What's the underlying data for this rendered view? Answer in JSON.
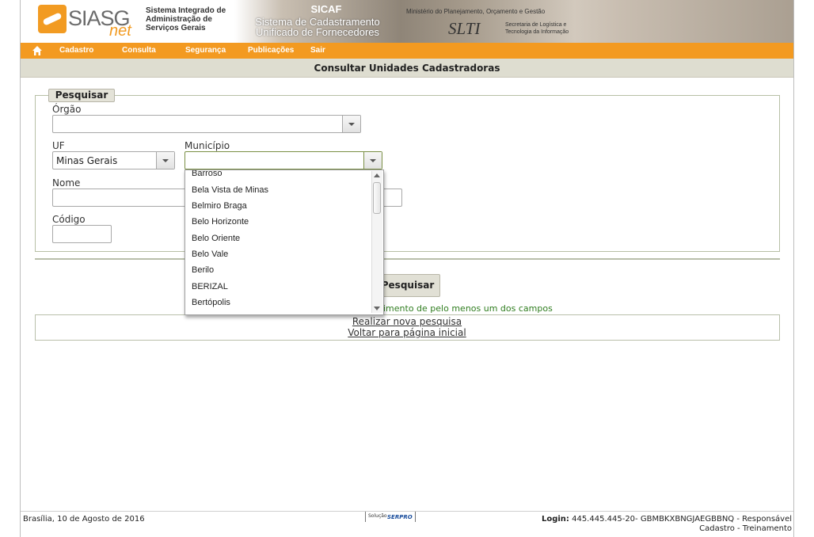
{
  "banner": {
    "logo_text": "SIASG",
    "logo_sub": "net",
    "system_name_line1": "Sistema Integrado de",
    "system_name_line2": "Administração de",
    "system_name_line3": "Serviços Gerais",
    "sicaf_title": "SICAF",
    "sicaf_line1": "Sistema de Cadastramento",
    "sicaf_line2": "Unificado de Fornecedores",
    "ministry": "Ministério do Planejamento, Orçamento e Gestão",
    "slti": "SLTI",
    "slti_desc_line1": "Secretaria de Logística e",
    "slti_desc_line2": "Tecnologia da Informação"
  },
  "menu": {
    "items": [
      "Cadastro",
      "Consulta",
      "Segurança",
      "Publicações",
      "Sair"
    ]
  },
  "page": {
    "title": "Consultar Unidades Cadastradoras"
  },
  "form": {
    "legend": "Pesquisar",
    "orgao_label": "Órgão",
    "orgao_value": "",
    "uf_label": "UF",
    "uf_value": "Minas Gerais",
    "municipio_label": "Município",
    "municipio_value": "",
    "nome_label": "Nome",
    "codigo_label": "Código",
    "search_button": "Pesquisar",
    "hint": "imento de pelo menos um dos campos"
  },
  "links": {
    "new_search": "Realizar nova pesquisa",
    "home": "Voltar para página inicial"
  },
  "dropdown": {
    "options": [
      "Barroso",
      "Bela Vista de Minas",
      "Belmiro Braga",
      "Belo Horizonte",
      "Belo Oriente",
      "Belo Vale",
      "Berilo",
      "BERIZAL",
      "Bertópolis"
    ]
  },
  "footer": {
    "date": "Brasília, 10 de Agosto de 2016",
    "solucao": "Solução",
    "serpro": "SERPRO",
    "login_label": "Login:",
    "login_value": "445.445.445-20- GBMBKXBNGJAEGBBNQ - Responsável",
    "login_line2": "Cadastro - Treinamento"
  },
  "colors": {
    "menu_orange": "#f39a21",
    "title_bar": "#deddd0",
    "hint_green": "#2f7d1f"
  }
}
